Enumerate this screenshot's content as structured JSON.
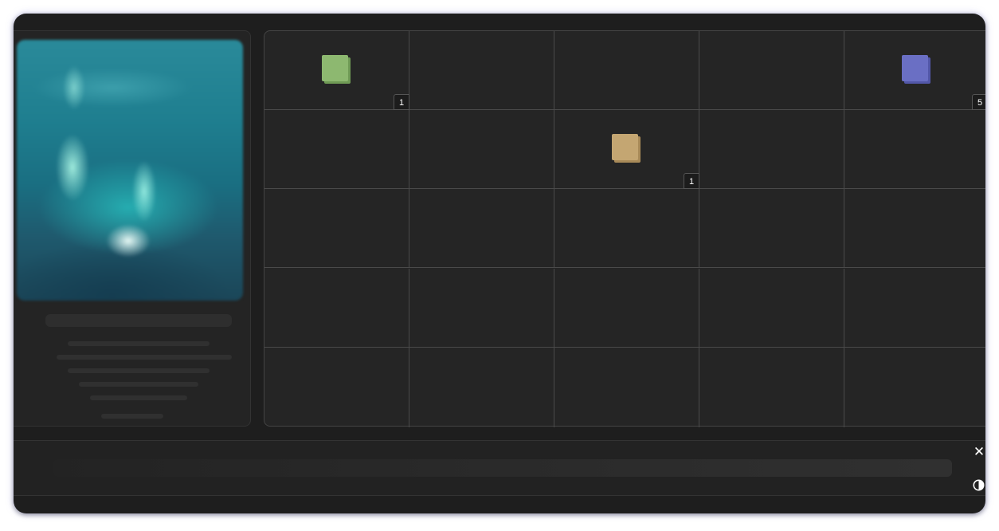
{
  "inventory": {
    "columns": 5,
    "rows": 5,
    "slots": [
      {
        "row": 0,
        "col": 0,
        "item": "green-block",
        "color": "#8db870",
        "shade": "#6f9a55",
        "count": "1"
      },
      {
        "row": 0,
        "col": 4,
        "item": "blue-block",
        "color": "#6a6fc4",
        "shade": "#5257a8",
        "count": "5"
      },
      {
        "row": 1,
        "col": 2,
        "item": "tan-block",
        "color": "#c4a672",
        "shade": "#a88a58",
        "count": "1"
      }
    ]
  },
  "controls": {
    "close_icon": "close-icon",
    "contrast_icon": "contrast-icon"
  }
}
